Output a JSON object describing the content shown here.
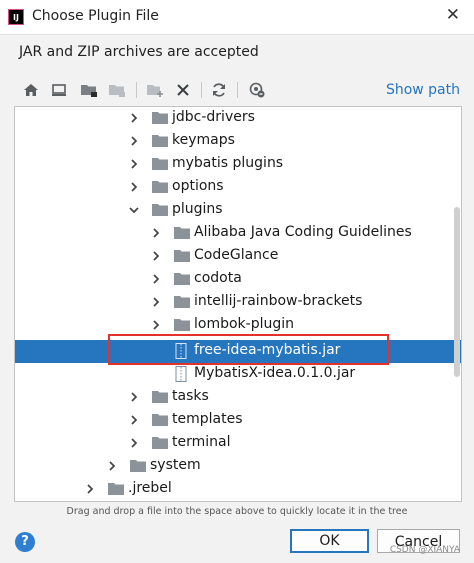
{
  "window": {
    "title": "Choose Plugin File",
    "app_icon_text": "IJ"
  },
  "subtitle": "JAR and ZIP archives are accepted",
  "toolbar": {
    "buttons": [
      "home-icon",
      "desktop-icon",
      "project-folder-icon",
      "module-folder-icon",
      "new-folder-icon",
      "delete-icon",
      "refresh-icon",
      "show-hidden-icon"
    ],
    "show_path": "Show path"
  },
  "tree": {
    "items": [
      {
        "label": "jdbc-drivers",
        "type": "folder",
        "expanded": false
      },
      {
        "label": "keymaps",
        "type": "folder",
        "expanded": false
      },
      {
        "label": "mybatis plugins",
        "type": "folder",
        "expanded": false
      },
      {
        "label": "options",
        "type": "folder",
        "expanded": false
      },
      {
        "label": "plugins",
        "type": "folder",
        "expanded": true
      },
      {
        "label": "Alibaba Java Coding Guidelines",
        "type": "folder",
        "expanded": false
      },
      {
        "label": "CodeGlance",
        "type": "folder",
        "expanded": false
      },
      {
        "label": "codota",
        "type": "folder",
        "expanded": false
      },
      {
        "label": "intellij-rainbow-brackets",
        "type": "folder",
        "expanded": false
      },
      {
        "label": "lombok-plugin",
        "type": "folder",
        "expanded": false
      },
      {
        "label": "free-idea-mybatis.jar",
        "type": "jar",
        "selected": true
      },
      {
        "label": "MybatisX-idea.0.1.0.jar",
        "type": "jar"
      },
      {
        "label": "tasks",
        "type": "folder",
        "expanded": false
      },
      {
        "label": "templates",
        "type": "folder",
        "expanded": false
      },
      {
        "label": "terminal",
        "type": "folder",
        "expanded": false
      },
      {
        "label": "system",
        "type": "folder",
        "expanded": false
      },
      {
        "label": ".jrebel",
        "type": "folder",
        "expanded": false
      }
    ]
  },
  "hint": "Drag and drop a file into the space above to quickly locate it in the tree",
  "buttons": {
    "ok": "OK",
    "cancel": "Cancel",
    "help": "?"
  },
  "watermark": "CSDN @XIANYA",
  "colors": {
    "accent": "#2675bf",
    "selection": "#2675bf",
    "highlight_box": "#e4312b",
    "folder": "#8c9299"
  }
}
